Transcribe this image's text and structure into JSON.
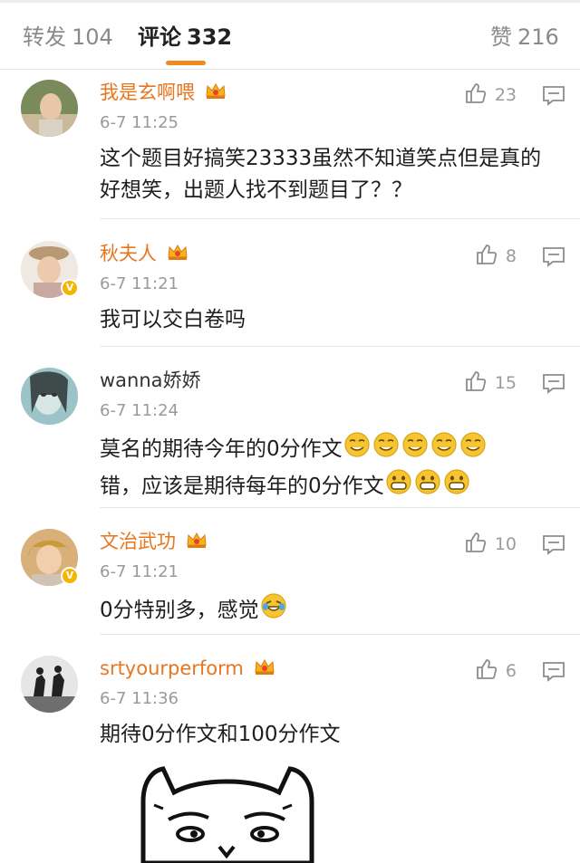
{
  "tabs": {
    "repost": {
      "label": "转发",
      "count": "104"
    },
    "comments": {
      "label": "评论",
      "count": "332"
    },
    "likes": {
      "label": "赞",
      "count": "216"
    }
  },
  "colors": {
    "accent": "#f08a1c",
    "vip_name": "#e8761f",
    "muted": "#9a9a9a"
  },
  "comments": [
    {
      "name": "我是玄啊喂",
      "time": "6-7 11:25",
      "likes": "23",
      "text": "这个题目好搞笑23333虽然不知道笑点但是真的好想笑，出题人找不到题目了？？"
    },
    {
      "name": "秋夫人",
      "time": "6-7 11:21",
      "likes": "8",
      "text": "我可以交白卷吗"
    },
    {
      "name": "wanna娇娇",
      "time": "6-7 11:24",
      "likes": "15",
      "line1": "莫名的期待今年的0分作文",
      "line2": "错，应该是期待每年的0分作文"
    },
    {
      "name": "文治武功",
      "time": "6-7 11:21",
      "likes": "10",
      "text": "0分特别多，感觉"
    },
    {
      "name": "srtyourperform",
      "time": "6-7 11:36",
      "likes": "6",
      "text": "期待0分作文和100分作文"
    }
  ],
  "icons": {
    "like": "thumbs-up-icon",
    "reply": "comment-reply-icon",
    "vip": "crown-icon",
    "verified": "verified-badge-icon"
  }
}
